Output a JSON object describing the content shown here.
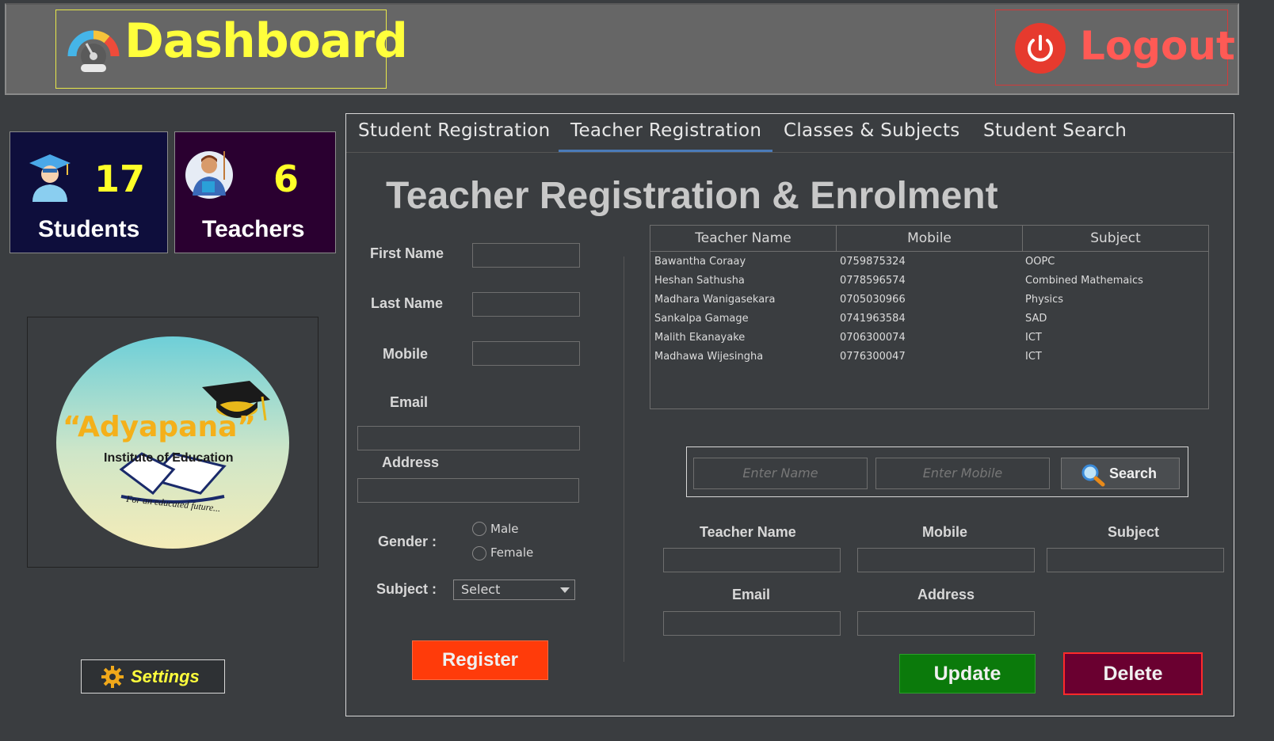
{
  "header": {
    "title": "Dashboard",
    "logout_label": "Logout"
  },
  "stats": {
    "students": {
      "count": "17",
      "label": "Students"
    },
    "teachers": {
      "count": "6",
      "label": "Teachers"
    }
  },
  "logo": {
    "name": "“Adyapana”",
    "subtitle": "Institute of Education",
    "tagline": "For an educated future..."
  },
  "settings_label": "Settings",
  "tabs": [
    {
      "label": "Student Registration"
    },
    {
      "label": "Teacher Registration"
    },
    {
      "label": "Classes & Subjects"
    },
    {
      "label": "Student Search"
    }
  ],
  "active_tab": "Teacher Registration",
  "form": {
    "title": "Teacher Registration & Enrolment",
    "first_name_label": "First Name",
    "last_name_label": "Last Name",
    "mobile_label": "Mobile",
    "email_label": "Email",
    "address_label": "Address",
    "gender_label": "Gender  :",
    "gender_options": [
      "Male",
      "Female"
    ],
    "subject_label": "Subject  :",
    "subject_selected": "Select",
    "register_label": "Register"
  },
  "table": {
    "columns": [
      "Teacher Name",
      "Mobile",
      "Subject"
    ],
    "rows": [
      [
        "Bawantha Coraay",
        "0759875324",
        "OOPC"
      ],
      [
        "Heshan Sathusha",
        "0778596574",
        "Combined Mathemaics"
      ],
      [
        "Madhara Wanigasekara",
        "0705030966",
        "Physics"
      ],
      [
        "Sankalpa Gamage",
        "0741963584",
        "SAD"
      ],
      [
        "Malith Ekanayake",
        "0706300074",
        "ICT"
      ],
      [
        "Madhawa Wijesingha",
        "0776300047",
        "ICT"
      ]
    ]
  },
  "search": {
    "name_placeholder": "Enter Name",
    "mobile_placeholder": "Enter Mobile",
    "button_label": "Search"
  },
  "edit": {
    "teacher_name_label": "Teacher Name",
    "mobile_label": "Mobile",
    "subject_label": "Subject",
    "email_label": "Email",
    "address_label": "Address",
    "update_label": "Update",
    "delete_label": "Delete"
  },
  "colors": {
    "header_bg": "#666666",
    "accent_yellow": "#ffff3c",
    "logout_red": "#ff5a55",
    "register": "#ff3b0a",
    "update": "#0b7a0b",
    "delete": "#6a0030",
    "tab_underline": "#4a7ab8"
  },
  "icons": {
    "dashboard": "speedometer-icon",
    "logout": "power-icon",
    "students": "graduate-icon",
    "teachers": "teacher-icon",
    "settings": "gear-icon",
    "search": "magnifier-icon"
  }
}
